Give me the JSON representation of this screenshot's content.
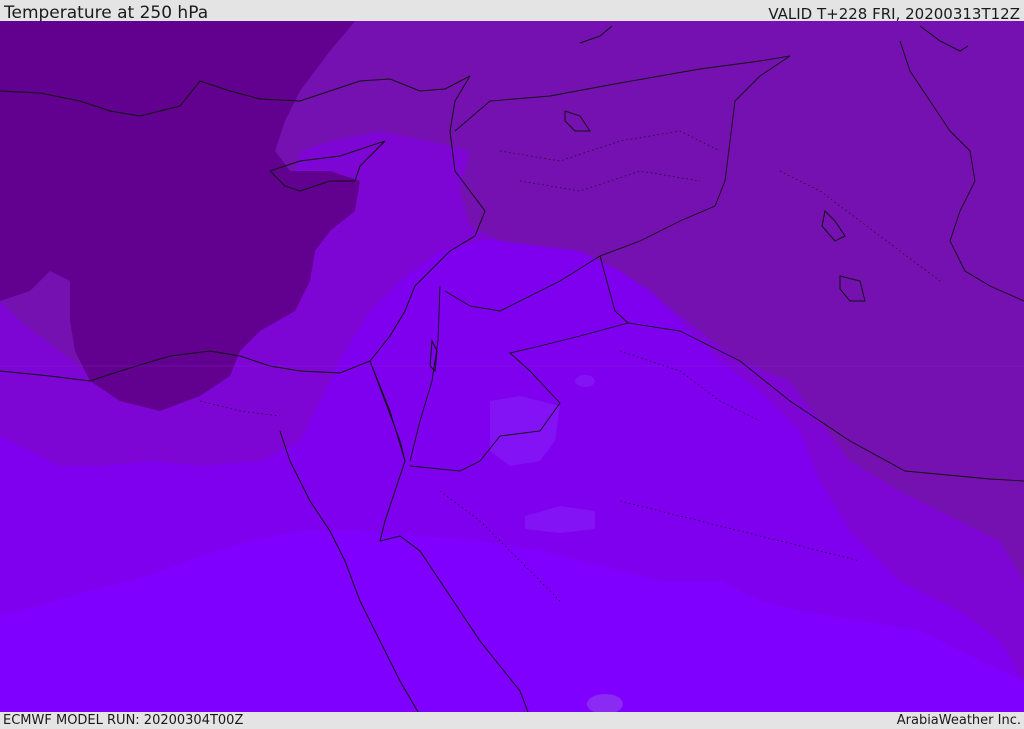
{
  "header": {
    "title": "Temperature at 250 hPa",
    "valid_time": "VALID T+228 FRI, 20200313T12Z"
  },
  "footer": {
    "model_run": "ECMWF MODEL RUN: 20200304T00Z",
    "credit": "ArabiaWeather Inc."
  },
  "map": {
    "field": "temperature-250hpa",
    "colors": {
      "coldest": "#62008f",
      "cold": "#7511b0",
      "mid": "#7d06d4",
      "warm": "#7f00ee",
      "warmest": "#7f00ff",
      "warm_patch": "#8313f5",
      "coastline": "#111111",
      "border": "#111111"
    }
  }
}
